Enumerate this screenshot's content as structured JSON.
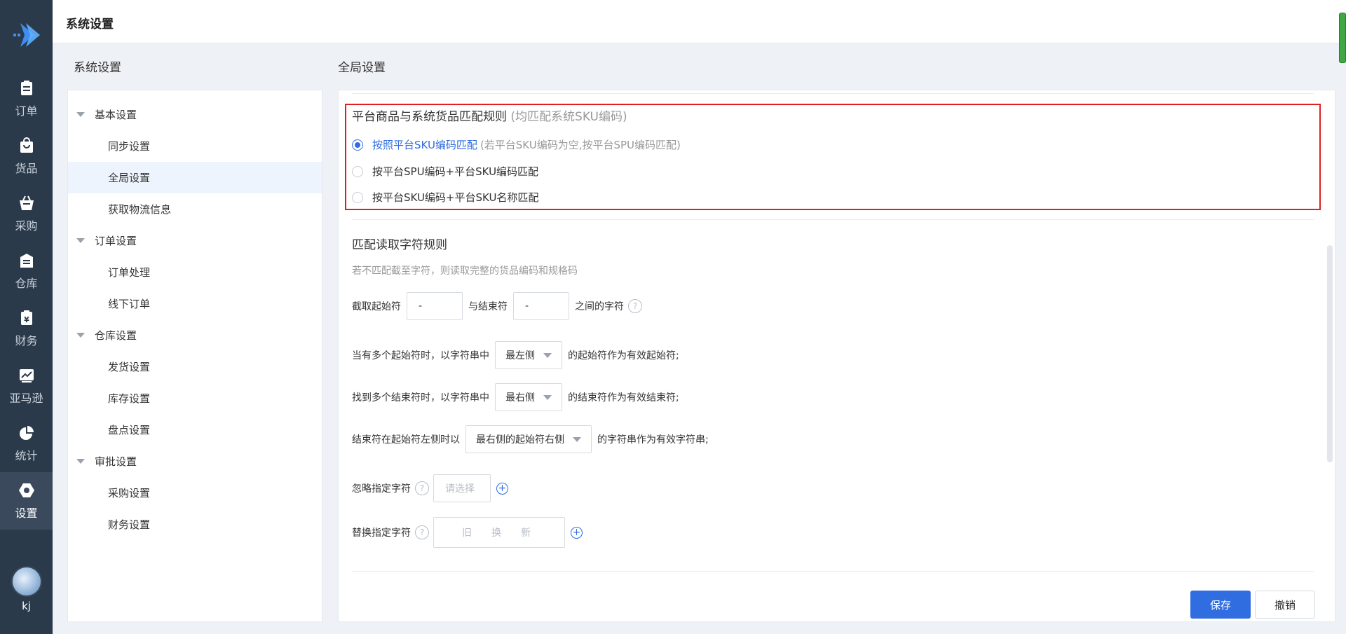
{
  "nav": {
    "items": [
      {
        "label": "订单",
        "icon": "order-icon"
      },
      {
        "label": "货品",
        "icon": "goods-icon"
      },
      {
        "label": "采购",
        "icon": "purchase-icon"
      },
      {
        "label": "仓库",
        "icon": "warehouse-icon"
      },
      {
        "label": "财务",
        "icon": "finance-icon"
      },
      {
        "label": "亚马逊",
        "icon": "amazon-chart-icon"
      },
      {
        "label": "统计",
        "icon": "pie-chart-icon"
      },
      {
        "label": "设置",
        "icon": "settings-icon"
      }
    ],
    "active": "设置",
    "user": "kj"
  },
  "header": {
    "title": "系统设置"
  },
  "left_section_title": "系统设置",
  "right_section_title": "全局设置",
  "tree": {
    "rows": [
      {
        "type": "group",
        "label": "基本设置"
      },
      {
        "type": "leaf",
        "label": "同步设置"
      },
      {
        "type": "leaf",
        "label": "全局设置",
        "selected": true
      },
      {
        "type": "leaf",
        "label": "获取物流信息"
      },
      {
        "type": "group",
        "label": "订单设置"
      },
      {
        "type": "leaf",
        "label": "订单处理"
      },
      {
        "type": "leaf",
        "label": "线下订单"
      },
      {
        "type": "group",
        "label": "仓库设置"
      },
      {
        "type": "leaf",
        "label": "发货设置"
      },
      {
        "type": "leaf",
        "label": "库存设置"
      },
      {
        "type": "leaf",
        "label": "盘点设置"
      },
      {
        "type": "group",
        "label": "审批设置"
      },
      {
        "type": "leaf",
        "label": "采购设置"
      },
      {
        "type": "leaf",
        "label": "财务设置"
      }
    ]
  },
  "match_rule": {
    "title": "平台商品与系统货品匹配规则",
    "title_hint": "(均匹配系统SKU编码)",
    "options": [
      {
        "label": "按照平台SKU编码匹配",
        "hint": "(若平台SKU编码为空,按平台SPU编码匹配)",
        "selected": true
      },
      {
        "label": "按平台SPU编码+平台SKU编码匹配",
        "hint": "",
        "selected": false
      },
      {
        "label": "按平台SKU编码+平台SKU名称匹配",
        "hint": "",
        "selected": false
      }
    ]
  },
  "read_rule": {
    "title": "匹配读取字符规则",
    "desc": "若不匹配截至字符，则读取完整的货品编码和规格码",
    "extract": {
      "prefix": "截取起始符",
      "start_value": "-",
      "mid": "与结束符",
      "end_value": "-",
      "suffix": "之间的字符"
    },
    "multi_start": {
      "prefix": "当有多个起始符时，以字符串中",
      "value": "最左侧",
      "suffix": "的起始符作为有效起始符;"
    },
    "multi_end": {
      "prefix": "找到多个结束符时，以字符串中",
      "value": "最右侧",
      "suffix": "的结束符作为有效结束符;"
    },
    "end_left": {
      "prefix": "结束符在起始符左侧时以",
      "value": "最右侧的起始符右侧",
      "suffix": "的字符串作为有效字符串;"
    },
    "ignore": {
      "label": "忽略指定字符",
      "placeholder": "请选择"
    },
    "replace": {
      "label": "替换指定字符",
      "old": "旧",
      "swap": "换",
      "new": "新"
    }
  },
  "actions": {
    "save": "保存",
    "cancel": "撤销"
  },
  "colors": {
    "nav_bg": "#2b3a4b",
    "accent": "#2f6de1",
    "highlight_border": "#e02020"
  }
}
